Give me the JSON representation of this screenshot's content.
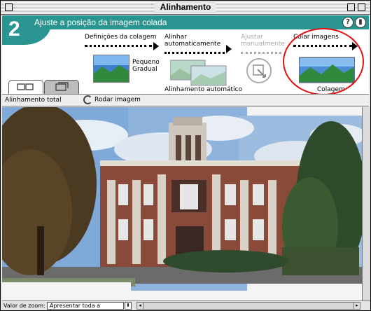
{
  "window": {
    "title": "Alinhamento"
  },
  "header": {
    "step_number": "2",
    "title": "Ajuste a posição da imagem colada",
    "help_label": "?",
    "collapse_label": "▮"
  },
  "steps": {
    "definicoes": {
      "label": "Definições da colagem",
      "thumb_label": "Pequeno Gradual"
    },
    "alinhar": {
      "label": "Alinhar automaticamente",
      "thumb_label": "Alinhamento automático"
    },
    "ajustar": {
      "label": "Ajustar manualmente",
      "disabled": true
    },
    "colar": {
      "label": "Colar imagens",
      "thumb_label": "Colagem",
      "highlighted": true
    }
  },
  "toolbar": {
    "alignment_label": "Alinhamento total",
    "rotate_label": "Rodar imagem"
  },
  "statusbar": {
    "zoom_label": "Valor de zoom:",
    "zoom_value": "Apresentar toda a imagem",
    "zoom_arrow": "⬍",
    "scroll_left": "◂",
    "scroll_right": "▸"
  },
  "colors": {
    "accent": "#2a9590",
    "highlight_circle": "#e01010"
  },
  "icons": [
    "tile-view-icon",
    "single-view-icon",
    "rotate-icon",
    "help-icon",
    "collapse-icon",
    "manual-adjust-icon"
  ]
}
